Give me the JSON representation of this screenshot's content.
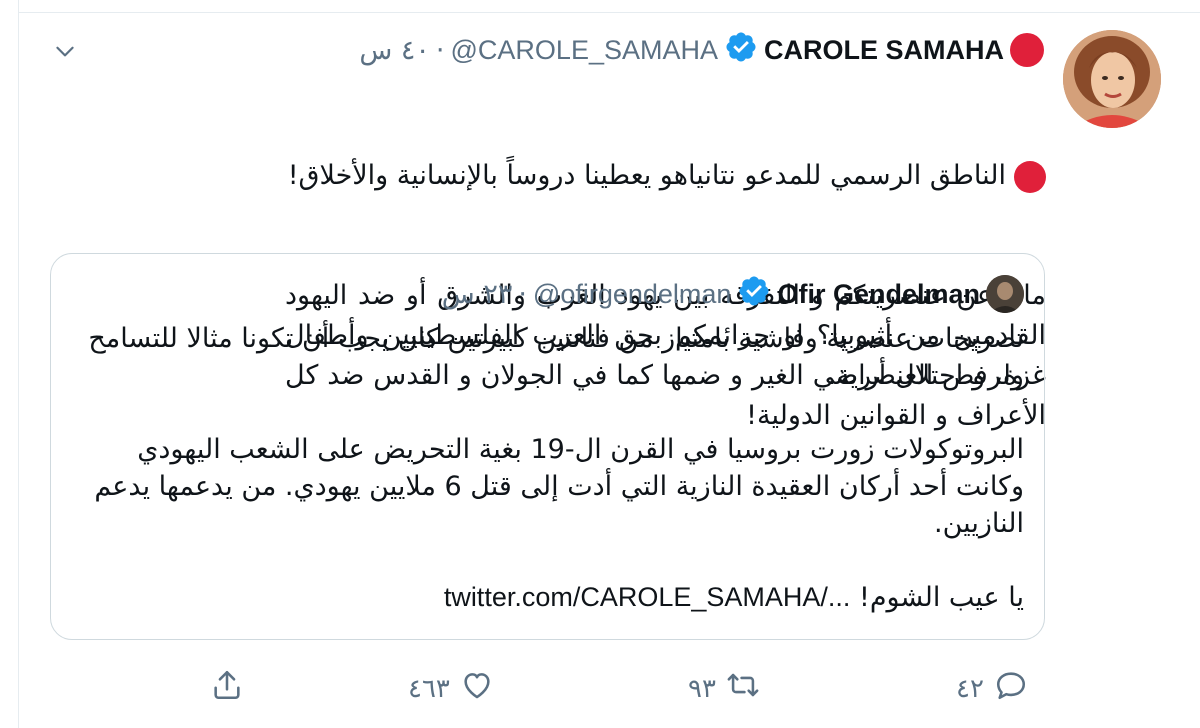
{
  "tweet": {
    "display_name": "CAROLE SAMAHA",
    "handle": "@CAROLE_SAMAHA",
    "separator": "·",
    "time": "٤٠ س",
    "text_line1": "الناطق الرسمي للمدعو نتانياهو يعطينا دروساً بالإنسانية والأخلاق!",
    "text_rest": "ماذا عن عنصريتكم و التفرقه بين يهود الغرب والشرق أو ضد اليهود القادمين من أثيوبيا؟ او جرائمكم بحق العرب الفلسطينيين وأطفال غزة، و احتلال أراضي الغير و ضمها كما في الجولان و القدس ضد كل الأعراف و القوانين الدولية!"
  },
  "quote": {
    "display_name": "Ofir Gendelman",
    "handle": "@ofirgendelman",
    "separator": "·",
    "time": "٢٣ س",
    "para1": "تصريحات عنصرية وفاشية بامتياز من فنانتين كبيرتين كان يجب أن تكونا مثالا للتسامح ولرفض العنصرية.",
    "para2": "البروتوكولات زورت بروسيا في القرن ال-19 بغية التحريض على الشعب اليهودي وكانت أحد أركان العقيدة النازية التي أدت إلى قتل 6 ملايين يهودي. من يدعمها يدعم النازيين.",
    "para3_text": "يا عيب الشوم!",
    "para3_link": "twitter.com/CAROLE_SAMAHA/..."
  },
  "actions": {
    "reply_count": "٤٢",
    "retweet_count": "٩٣",
    "like_count": "٤٦٣",
    "share_label": ""
  },
  "icons": {
    "chevron": "chevron-down-icon",
    "verified": "verified-badge-icon",
    "reply": "reply-icon",
    "retweet": "retweet-icon",
    "like": "heart-icon",
    "share": "share-icon"
  },
  "colors": {
    "accent": "#1d9bf0",
    "muted": "#5b7083",
    "red_dot": "#e0203a",
    "border": "#cfd9de"
  }
}
